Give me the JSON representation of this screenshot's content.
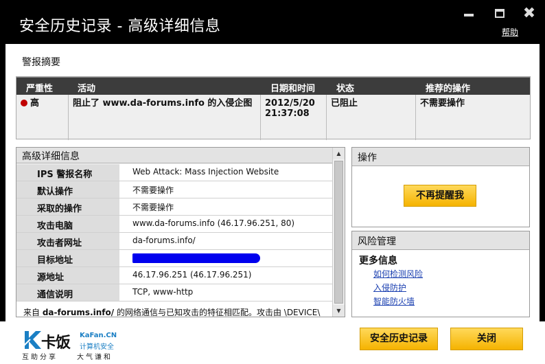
{
  "window": {
    "title": "安全历史记录 - 高级详细信息",
    "help": "帮助",
    "close_glyph": "✖"
  },
  "summary": {
    "title": "警报摘要",
    "columns": [
      "严重性",
      "活动",
      "日期和时间",
      "状态",
      "推荐的操作"
    ],
    "row": {
      "severity": "高",
      "activity": "阻止了 www.da-forums.info 的入侵企图",
      "date": "2012/5/20",
      "time": "21:37:08",
      "status": "已阻止",
      "action": "不需要操作"
    },
    "colors": {
      "header_bg": "#3c3c3c",
      "severity_dot": "#c00000"
    }
  },
  "details": {
    "title": "高级详细信息",
    "rows": [
      {
        "label": "IPS 警报名称",
        "value": "Web Attack: Mass Injection Website"
      },
      {
        "label": "默认操作",
        "value": "不需要操作"
      },
      {
        "label": "采取的操作",
        "value": "不需要操作"
      },
      {
        "label": "攻击电脑",
        "value": "www.da-forums.info (46.17.96.251, 80)"
      },
      {
        "label": "攻击者网址",
        "value": "da-forums.info/"
      },
      {
        "label": "目标地址",
        "value": ""
      },
      {
        "label": "源地址",
        "value": "46.17.96.251 (46.17.96.251)"
      },
      {
        "label": "通信说明",
        "value": "TCP, www-http"
      }
    ],
    "footer_prefix": "来自 ",
    "footer_bold": "da-forums.info/",
    "footer_rest": " 的网络通信与已知攻击的特征相匹配。攻击由 \\DEVICE\\"
  },
  "actions": {
    "title": "操作",
    "dont_remind": "不再提醒我"
  },
  "risk": {
    "title": "风险管理",
    "subtitle": "更多信息",
    "links": [
      "如何检测风险",
      "入侵防护",
      "智能防火墙"
    ]
  },
  "footer": {
    "logo_cn": "卡饭",
    "logo_en": "KaFan.CN",
    "logo_sec": "计算机安全",
    "logo_line1": "互助分享",
    "logo_line2": "大气谦和",
    "history_button": "安全历史记录",
    "close_button": "关闭",
    "accent": "#f5b300"
  }
}
